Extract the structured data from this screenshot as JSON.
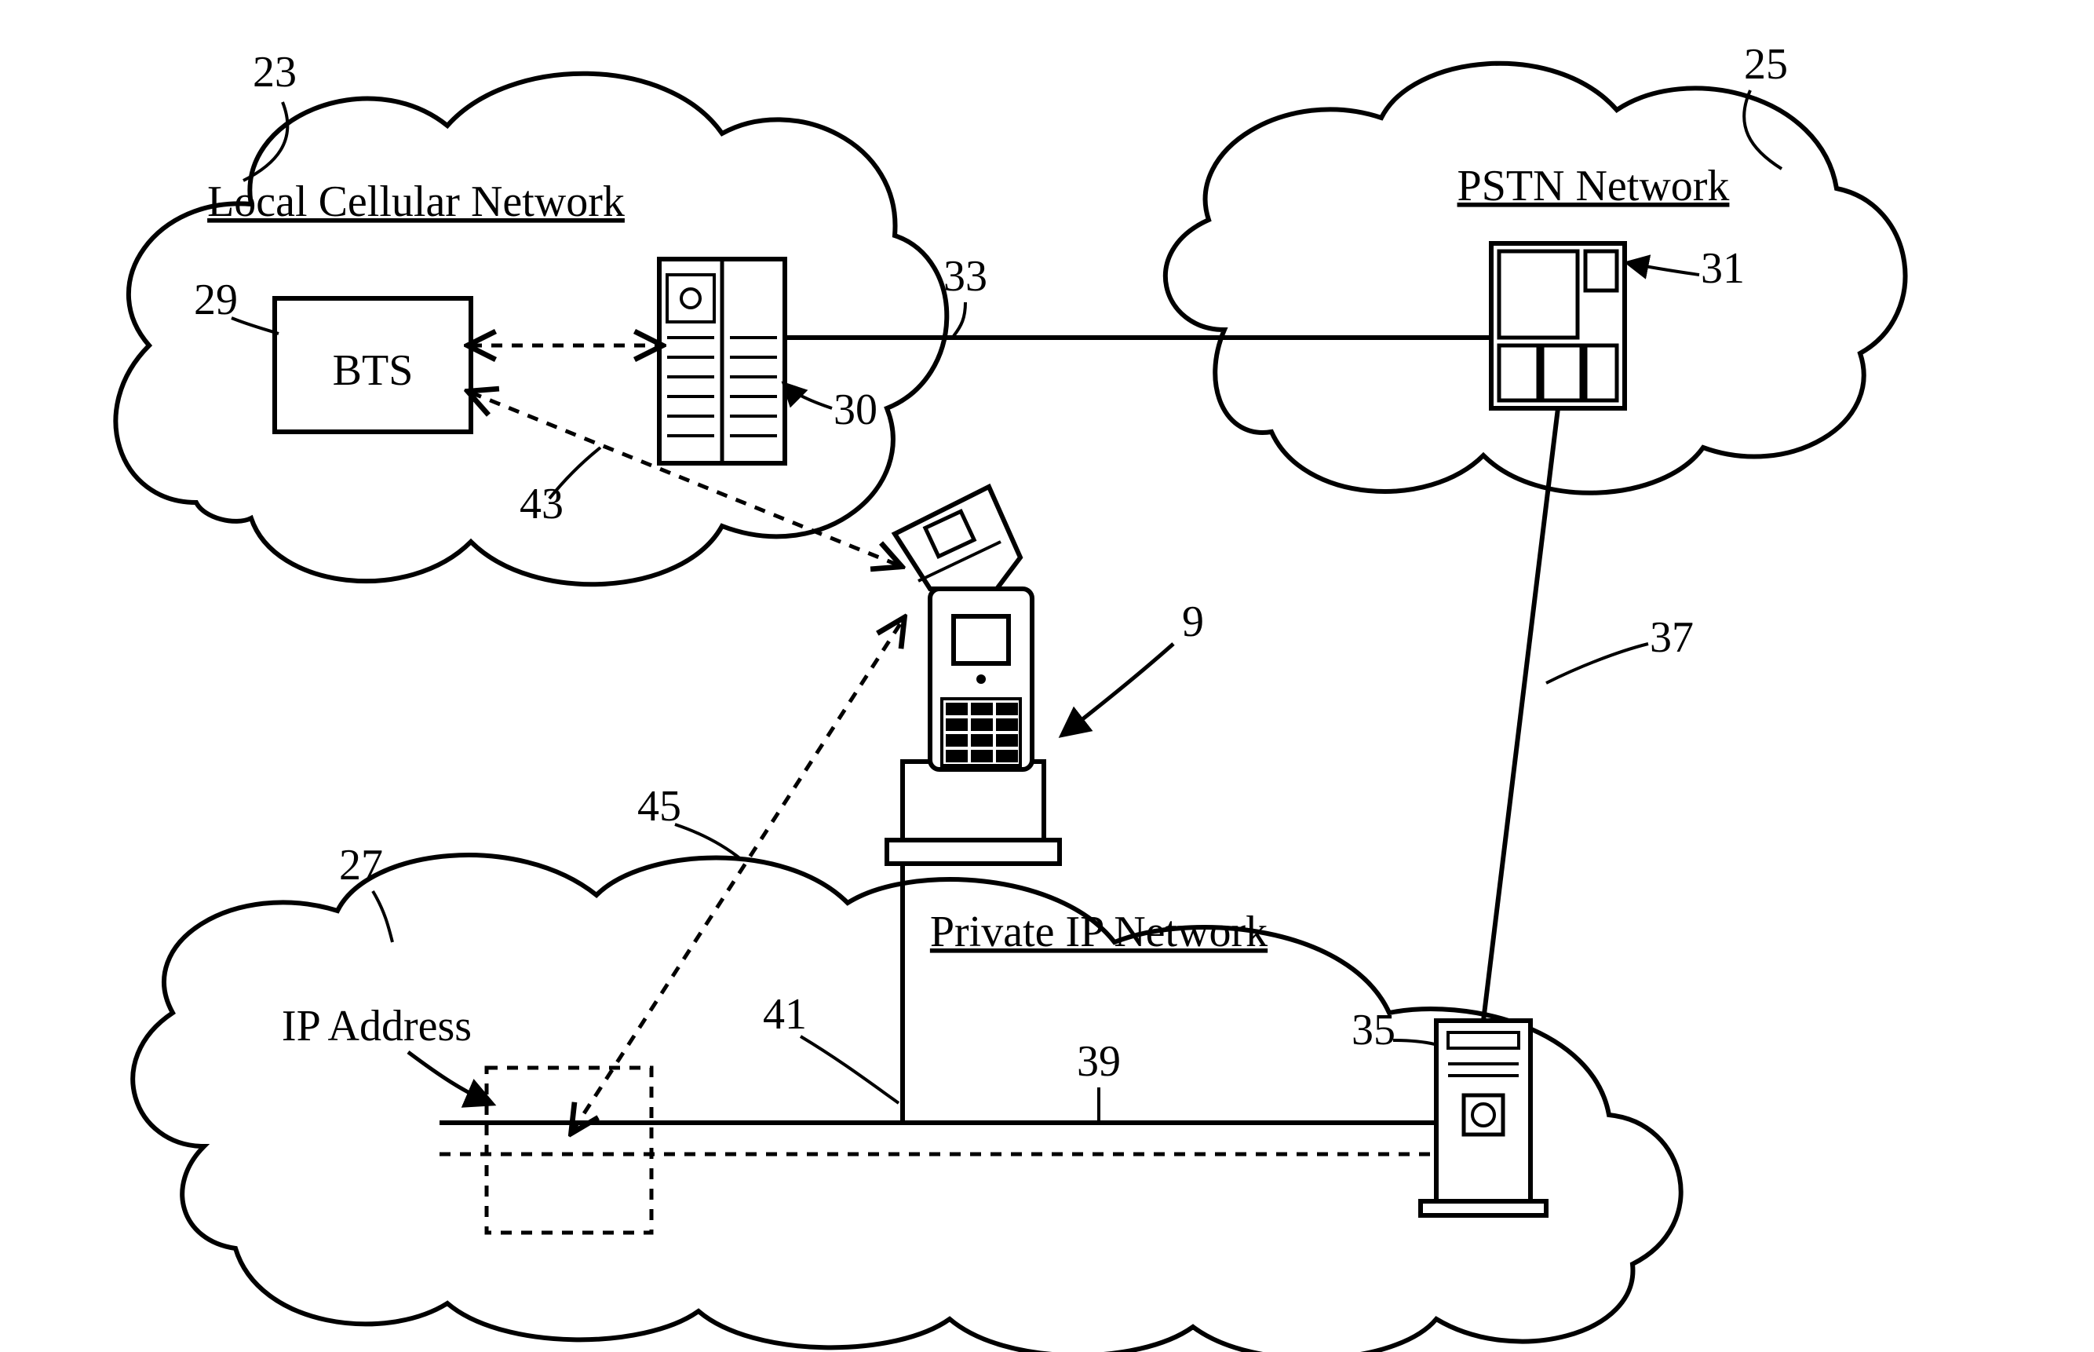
{
  "labels": {
    "cloud_cellular_title": "Local Cellular Network",
    "cloud_pstn_title": "PSTN Network",
    "cloud_ip_title": "Private IP Network",
    "bts_box": "BTS",
    "ip_address": "IP Address"
  },
  "refnums": {
    "r23": "23",
    "r25": "25",
    "r27": "27",
    "r29": "29",
    "r30": "30",
    "r31": "31",
    "r33": "33",
    "r35": "35",
    "r37": "37",
    "r39": "39",
    "r41": "41",
    "r43": "43",
    "r45": "45",
    "r9": "9"
  }
}
